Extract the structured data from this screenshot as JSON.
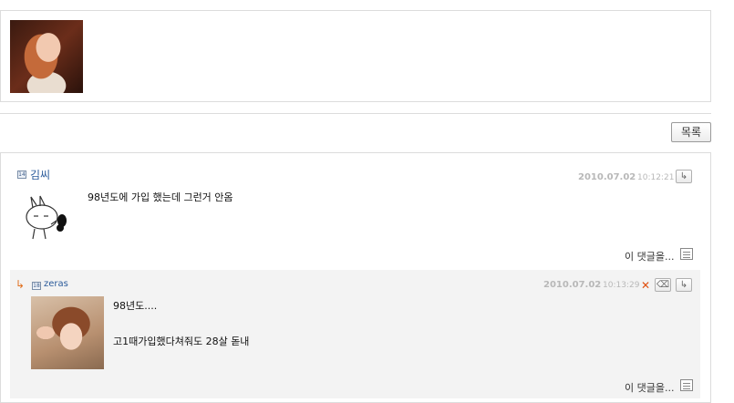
{
  "toolbar": {
    "list_label": "목록"
  },
  "comments": [
    {
      "level": "14",
      "author": "김씨",
      "date": "2010.07.02",
      "time": "10:12:21",
      "text": "98년도에 가입 했는데 그런거 안옴",
      "this_comment_label": "이 댓글을..."
    },
    {
      "level": "18",
      "author": "zeras",
      "date": "2010.07.02",
      "time": "10:13:29",
      "text_line1": "98년도....",
      "text_line2": "고1때가입했다쳐줘도 28살 돋내",
      "this_comment_label": "이 댓글을...",
      "reply_arrow": "↳",
      "delete_symbol": "✕"
    }
  ],
  "icons": {
    "reply_button": "↳",
    "edit_button": "⌫"
  },
  "colors": {
    "author": "#2a5a9a",
    "reply_arrow": "#e07020",
    "reply_bg": "#f3f3f3"
  }
}
